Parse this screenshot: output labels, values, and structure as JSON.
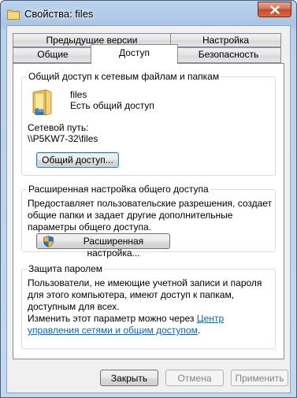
{
  "window": {
    "title": "Свойства: files",
    "close_symbol": "×"
  },
  "tabs": {
    "row_back": [
      "Предыдущие версии",
      "Настройка"
    ],
    "row_front": [
      "Общие",
      "Доступ",
      "Безопасность"
    ],
    "active": "Доступ"
  },
  "network_sharing": {
    "title": "Общий доступ к сетевым файлам и папкам",
    "folder_name": "files",
    "folder_status": "Есть общий доступ",
    "path_label": "Сетевой путь:",
    "path_value": "\\\\P5KW7-32\\files",
    "share_button": "Общий доступ..."
  },
  "advanced_sharing": {
    "title": "Расширенная настройка общего доступа",
    "description": "Предоставляет пользовательские разрешения, создает общие папки и задает другие дополнительные параметры общего доступа.",
    "button": "Расширенная настройка..."
  },
  "password_protection": {
    "title": "Защита паролем",
    "description": "Пользователи, не имеющие учетной записи и пароля для этого компьютера, имеют доступ к папкам, доступным для всех.",
    "change_text": "Изменить этот параметр можно через",
    "link_text": "Центр управления сетями и общим доступом",
    "period": "."
  },
  "footer": {
    "close": "Закрыть",
    "cancel": "Отмена",
    "apply": "Применить"
  },
  "icons": {
    "window": "folder-icon",
    "folder": "shared-folder-icon",
    "uac": "uac-shield-icon"
  }
}
